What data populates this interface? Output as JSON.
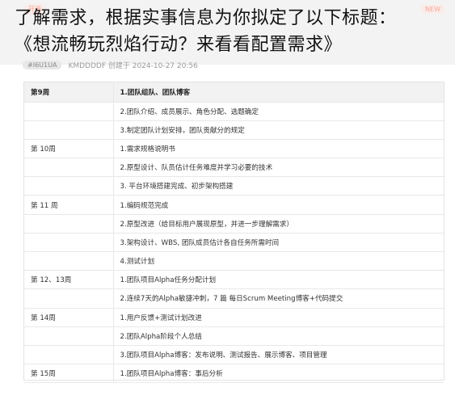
{
  "title_line1": "了解需求，根据实事信息为你拟定了以下标题：",
  "title_line2": "《想流畅玩烈焰行动？来看看配置需求》",
  "meta": {
    "badge_open": "开源",
    "badge_new": "NEW"
  },
  "subbar": {
    "tag": "#I6U1UA",
    "info": "KMDDDDF 创建于 2024-10-27 20:56"
  },
  "table": {
    "header": {
      "week": "第9周",
      "task": "1.团队组队、团队博客"
    },
    "rows": [
      {
        "week": "",
        "task": "2.团队介绍、成员展示、角色分配、选题确定"
      },
      {
        "week": "",
        "task": "3.制定团队计划安排，团队贡献分的规定"
      },
      {
        "week": "第 10周",
        "task": "1.需求规格说明书"
      },
      {
        "week": "",
        "task": "2.原型设计、队员估计任务难度并学习必要的技术"
      },
      {
        "week": "",
        "task": "3. 平台环境搭建完成、初步架构搭建"
      },
      {
        "week": "第 11 周",
        "task": "1.编码规范完成"
      },
      {
        "week": "",
        "task": "2.原型改进（给目标用户展现原型，并进一步理解需求）"
      },
      {
        "week": "",
        "task": "3.架构设计、WBS, 团队成员估计各自任务所需时间"
      },
      {
        "week": "",
        "task": "4.测试计划"
      },
      {
        "week": "第 12、13周",
        "task": "1.团队项目Alpha任务分配计划"
      },
      {
        "week": "",
        "task": "2.连续7天的Alpha敏捷冲刺，7 篇 每日Scrum Meeting博客+代码提交"
      },
      {
        "week": "第 14周",
        "task": "1.用户反馈+测试计划改进"
      },
      {
        "week": "",
        "task": "2.团队Alpha阶段个人总结"
      },
      {
        "week": "",
        "task": "3.团队项目Alpha博客：发布说明、测试报告、展示博客、项目管理"
      },
      {
        "week": "第 15周",
        "task": "1.团队项目Alpha博客：事后分析"
      }
    ]
  }
}
